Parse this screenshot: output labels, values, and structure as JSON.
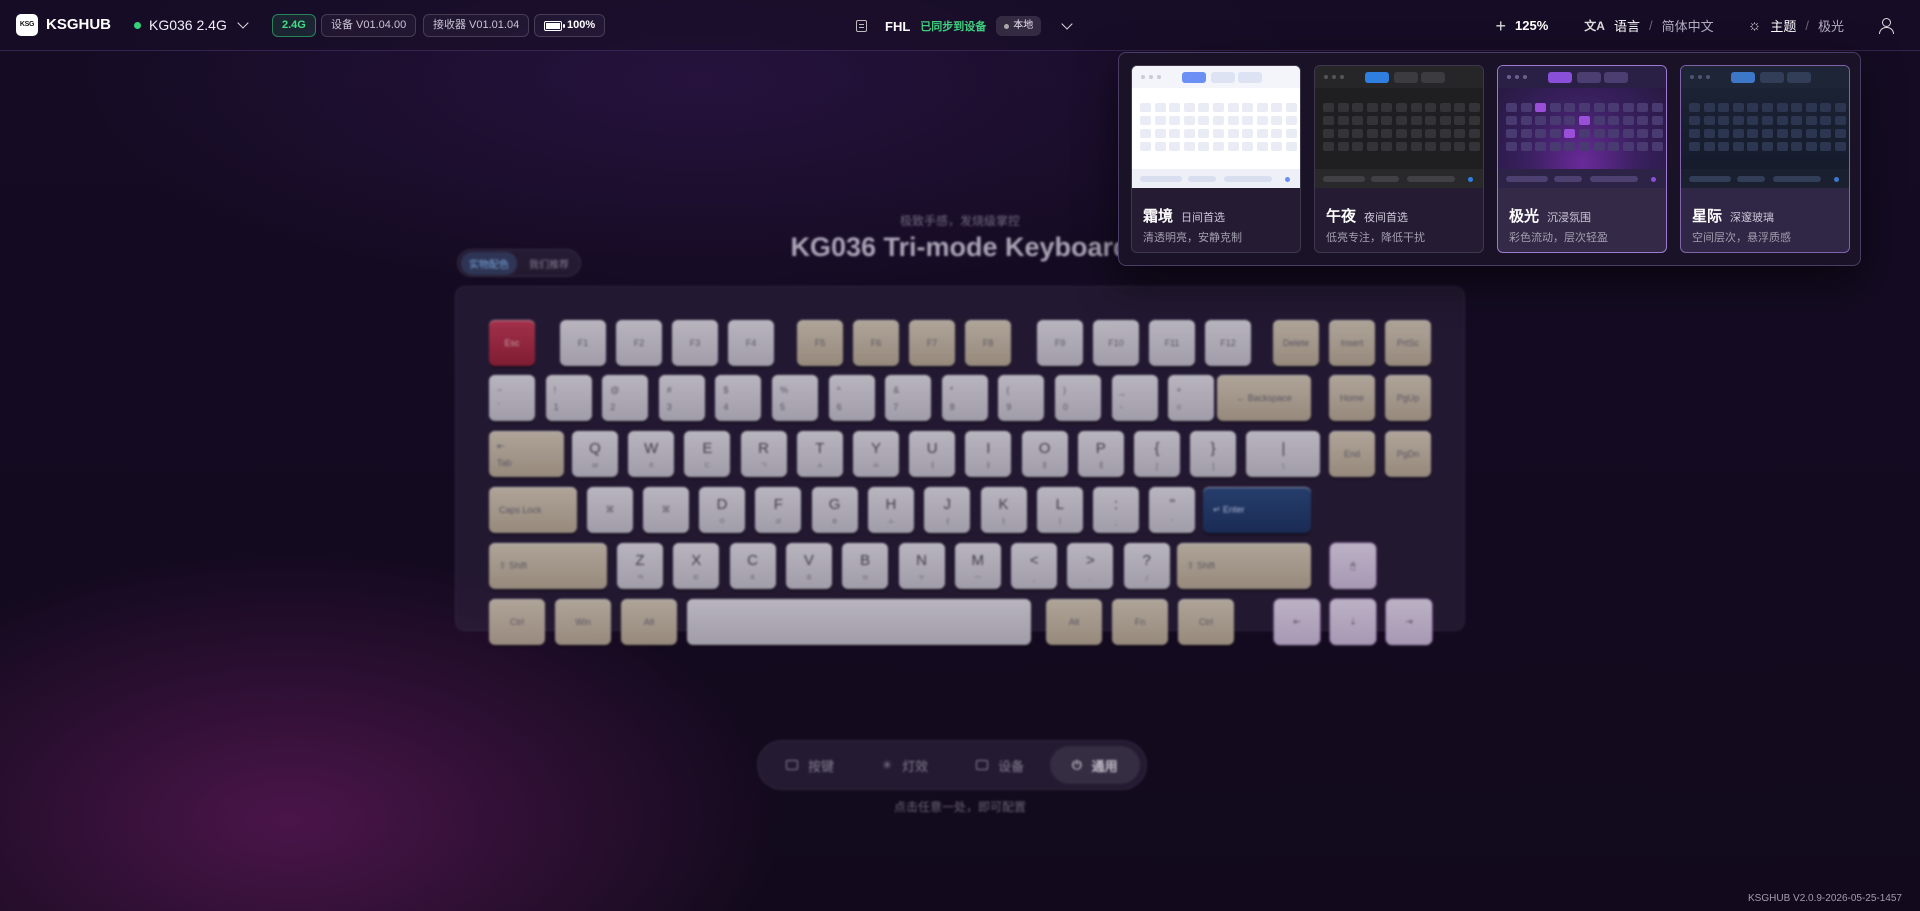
{
  "topbar": {
    "logo_mark": "KSG",
    "brand": "KSGHUB",
    "device_name": "KG036 2.4G",
    "connection_badge": "2.4G",
    "device_firmware": "设备 V01.04.00",
    "receiver_firmware": "接收器 V01.01.04",
    "battery": "100%",
    "profile_name": "FHL",
    "sync_status": "已同步到设备",
    "storage_badge": "本地",
    "zoom": "125%",
    "language_label": "语言",
    "language_value": "简体中文",
    "theme_label": "主题",
    "theme_value": "极光",
    "separator": "/"
  },
  "main": {
    "tagline": "极致手感，发烧级掌控",
    "title": "KG036 Tri-mode Keyboard",
    "mode_toggle": [
      "实物配色",
      "我们推荐"
    ],
    "nav": [
      {
        "label": "按键",
        "icon": "keyboard-icon",
        "active": false
      },
      {
        "label": "灯效",
        "icon": "light-icon",
        "active": false
      },
      {
        "label": "设备",
        "icon": "device-icon",
        "active": false
      },
      {
        "label": "通用",
        "icon": "power-icon",
        "active": true
      }
    ],
    "hint": "点击任意一处，即可配置"
  },
  "keyboard": {
    "fn_row": [
      "Esc",
      "F1",
      "F2",
      "F3",
      "F4",
      "F5",
      "F6",
      "F7",
      "F8",
      "F9",
      "F10",
      "F11",
      "F12",
      "Delete",
      "Insert",
      "PrtSc"
    ],
    "number_row": [
      {
        "top": "~",
        "bottom": "`"
      },
      {
        "top": "!",
        "bottom": "1"
      },
      {
        "top": "@",
        "bottom": "2"
      },
      {
        "top": "#",
        "bottom": "3"
      },
      {
        "top": "$",
        "bottom": "4"
      },
      {
        "top": "%",
        "bottom": "5"
      },
      {
        "top": "^",
        "bottom": "6"
      },
      {
        "top": "&",
        "bottom": "7"
      },
      {
        "top": "*",
        "bottom": "8"
      },
      {
        "top": "(",
        "bottom": "9"
      },
      {
        "top": ")",
        "bottom": "0"
      },
      {
        "top": "_",
        "bottom": "-"
      },
      {
        "top": "+",
        "bottom": "="
      }
    ],
    "backspace": "← Backspace",
    "home": "Home",
    "pgup": "PgUp",
    "tab": "Tab",
    "qwerty_row": [
      {
        "main": "Q",
        "sub": "ㅂ"
      },
      {
        "main": "W",
        "sub": "ㅈ"
      },
      {
        "main": "E",
        "sub": "ㄷ"
      },
      {
        "main": "R",
        "sub": "ㄱ"
      },
      {
        "main": "T",
        "sub": "ㅅ"
      },
      {
        "main": "Y",
        "sub": "ㅛ"
      },
      {
        "main": "U",
        "sub": "ㅕ"
      },
      {
        "main": "I",
        "sub": "ㅑ"
      },
      {
        "main": "O",
        "sub": "ㅐ"
      },
      {
        "main": "P",
        "sub": "ㅔ"
      },
      {
        "main": "{",
        "sub": "["
      },
      {
        "main": "}",
        "sub": "]"
      },
      {
        "main": "|",
        "sub": "\\"
      }
    ],
    "end": "End",
    "pgdn": "PgDn",
    "caps": "Caps Lock",
    "asdf_row": [
      {
        "main": "D",
        "sub": "ㅇ"
      },
      {
        "main": "F",
        "sub": "ㄹ"
      },
      {
        "main": "G",
        "sub": "ㅎ"
      },
      {
        "main": "H",
        "sub": "ㅗ"
      },
      {
        "main": "J",
        "sub": "ㅓ"
      },
      {
        "main": "K",
        "sub": "ㅏ"
      },
      {
        "main": "L",
        "sub": "ㅣ"
      },
      {
        "main": ":",
        "sub": ";"
      },
      {
        "main": "\"",
        "sub": "'"
      }
    ],
    "enter": "↵ Enter",
    "shift": "Shift",
    "zxcv_row": [
      {
        "main": "Z",
        "sub": "ㅋ"
      },
      {
        "main": "X",
        "sub": "ㅌ"
      },
      {
        "main": "C",
        "sub": "ㅊ"
      },
      {
        "main": "V",
        "sub": "ㅍ"
      },
      {
        "main": "B",
        "sub": "ㅠ"
      },
      {
        "main": "N",
        "sub": "ㅜ"
      },
      {
        "main": "M",
        "sub": "ㅡ"
      },
      {
        "main": "<",
        "sub": ","
      },
      {
        "main": ">",
        "sub": "."
      },
      {
        "main": "?",
        "sub": "/"
      }
    ],
    "ctrl": "Ctrl",
    "win": "Win",
    "alt": "Alt",
    "fn": "Fn"
  },
  "theme_menu": {
    "cards": [
      {
        "name": "霜境",
        "tag": "日间首选",
        "desc": "清透明亮，安静克制",
        "state": "normal"
      },
      {
        "name": "午夜",
        "tag": "夜间首选",
        "desc": "低亮专注，降低干扰",
        "state": "normal"
      },
      {
        "name": "极光",
        "tag": "沉浸氛围",
        "desc": "彩色流动，层次轻盈",
        "state": "active"
      },
      {
        "name": "星际",
        "tag": "深邃玻璃",
        "desc": "空间层次，悬浮质感",
        "state": "hover"
      }
    ],
    "accent_colors": {
      "frost": "#6b8ff5",
      "midnight": "#2f7fe0",
      "aurora": "#8a4fd8",
      "stellar": "#3d78c8"
    }
  },
  "footer": {
    "version": "KSGHUB V2.0.9-2026-05-25-1457"
  },
  "colors": {
    "status_green": "#34d27a",
    "escape_red": "#c83a55",
    "enter_blue": "#2b4b80"
  }
}
